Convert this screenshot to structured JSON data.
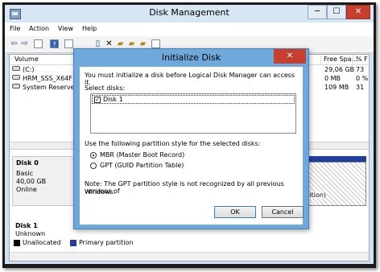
{
  "window": {
    "title": "Disk Management",
    "min": "─",
    "max": "☐",
    "close": "✕"
  },
  "menu": [
    "File",
    "Action",
    "View",
    "Help"
  ],
  "toolbar_icons": [
    "back-icon",
    "forward-icon",
    "grid-icon",
    "help-icon",
    "properties-icon",
    "delete-icon",
    "folder-icon",
    "search-icon"
  ],
  "columns": {
    "volume": "Volume",
    "free": "Free Spa...",
    "pct": "% F"
  },
  "volumes": [
    {
      "name": "(C:)",
      "free": "29,06 GB",
      "pct": "73"
    },
    {
      "name": "HRM_SSS_X64F",
      "free": "0 MB",
      "pct": "0 %"
    },
    {
      "name": "System Reserve",
      "free": "109 MB",
      "pct": "31"
    }
  ],
  "disks": [
    {
      "name": "Disk 0",
      "type": "Basic",
      "size": "40,00 GB",
      "status": "Online",
      "partition_label": "ry Partition)"
    },
    {
      "name": "Disk 1",
      "type": "Unknown"
    }
  ],
  "legend": [
    {
      "label": "Unallocated",
      "color": "#000000"
    },
    {
      "label": "Primary partition",
      "color": "#1f3fa0"
    }
  ],
  "dialog": {
    "title": "Initialize Disk",
    "close": "✕",
    "intro": "You must initialize a disk before Logical Disk Manager can access it.",
    "select_label": "Select disks:",
    "disks": [
      {
        "label": "Disk 1",
        "checked": true
      }
    ],
    "style_label": "Use the following partition style for the selected disks:",
    "options": [
      {
        "label": "MBR (Master Boot Record)",
        "selected": true
      },
      {
        "label": "GPT (GUID Partition Table)",
        "selected": false
      }
    ],
    "note_line1": "Note: The GPT partition style is not recognized by all previous versions of",
    "note_line2": "Windows.",
    "ok": "OK",
    "cancel": "Cancel"
  }
}
